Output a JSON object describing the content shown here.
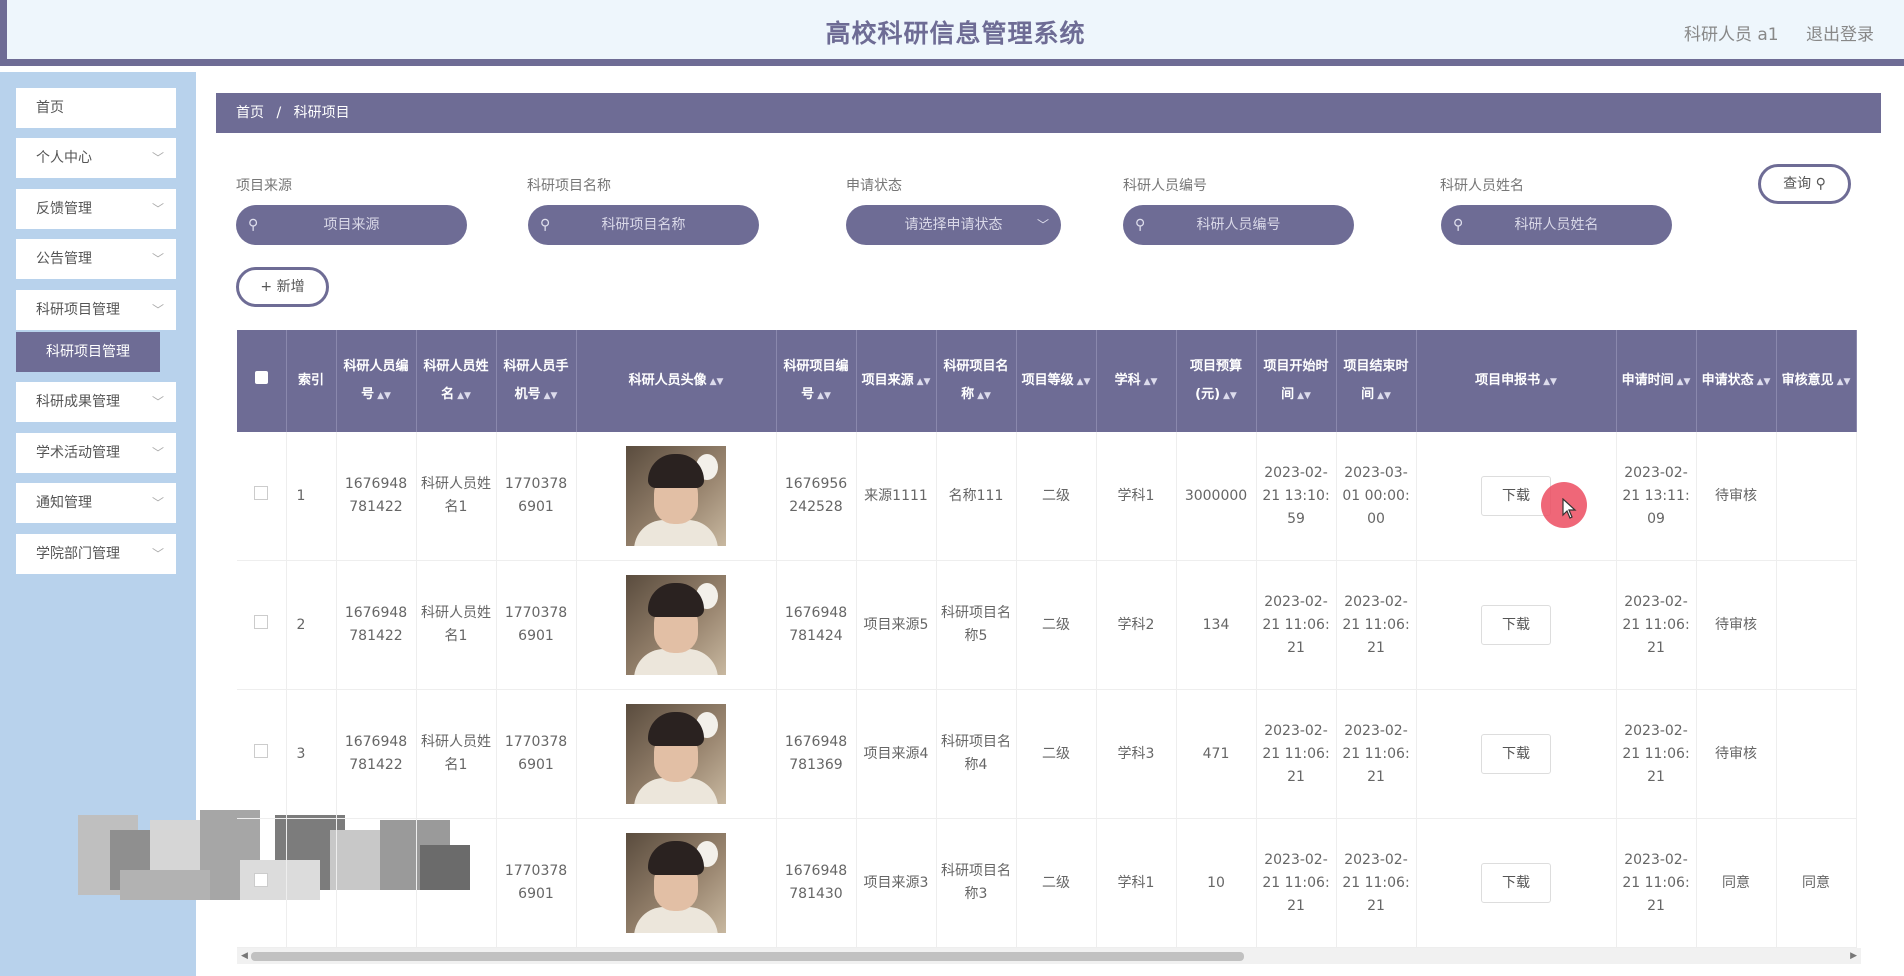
{
  "app": {
    "title": "高校科研信息管理系统"
  },
  "header": {
    "user_label": "科研人员 a1",
    "logout_label": "退出登录"
  },
  "sidebar": {
    "items": [
      {
        "label": "首页"
      },
      {
        "label": "个人中心"
      },
      {
        "label": "反馈管理"
      },
      {
        "label": "公告管理"
      },
      {
        "label": "科研项目管理"
      },
      {
        "label": "科研成果管理"
      },
      {
        "label": "学术活动管理"
      },
      {
        "label": "通知管理"
      },
      {
        "label": "学院部门管理"
      }
    ],
    "active_sub": "科研项目管理"
  },
  "breadcrumb": {
    "home": "首页",
    "separator": "/",
    "current": "科研项目"
  },
  "filters": {
    "source": {
      "label": "项目来源",
      "placeholder": "项目来源"
    },
    "name": {
      "label": "科研项目名称",
      "placeholder": "科研项目名称"
    },
    "status": {
      "label": "申请状态",
      "placeholder": "请选择申请状态"
    },
    "staff_no": {
      "label": "科研人员编号",
      "placeholder": "科研人员编号"
    },
    "staff_name": {
      "label": "科研人员姓名",
      "placeholder": "科研人员姓名"
    },
    "search_label": "查询",
    "add_label": "新增"
  },
  "table": {
    "headers": {
      "index": "索引",
      "staff_no": "科研人员编号",
      "staff_name": "科研人员姓名",
      "phone": "科研人员手机号",
      "avatar": "科研人员头像",
      "project_no": "科研项目编号",
      "source": "项目来源",
      "project_name": "科研项目名称",
      "level": "项目等级",
      "subject": "学科",
      "budget": "项目预算(元)",
      "start": "项目开始时间",
      "end": "项目结束时间",
      "proposal": "项目申报书",
      "apply_time": "申请时间",
      "status": "申请状态",
      "review": "审核意见"
    },
    "rows": [
      {
        "index": "1",
        "staff_no": "1676948781422",
        "staff_name": "科研人员姓名1",
        "phone": "17703786901",
        "project_no": "1676956242528",
        "source": "来源1111",
        "project_name": "名称111",
        "level": "二级",
        "subject": "学科1",
        "budget": "3000000",
        "start": "2023-02-21 13:10:59",
        "end": "2023-03-01 00:00:00",
        "proposal": "下载",
        "apply_time": "2023-02-21 13:11:09",
        "status": "待审核",
        "review": ""
      },
      {
        "index": "2",
        "staff_no": "1676948781422",
        "staff_name": "科研人员姓名1",
        "phone": "17703786901",
        "project_no": "1676948781424",
        "source": "项目来源5",
        "project_name": "科研项目名称5",
        "level": "二级",
        "subject": "学科2",
        "budget": "134",
        "start": "2023-02-21 11:06:21",
        "end": "2023-02-21 11:06:21",
        "proposal": "下载",
        "apply_time": "2023-02-21 11:06:21",
        "status": "待审核",
        "review": ""
      },
      {
        "index": "3",
        "staff_no": "1676948781422",
        "staff_name": "科研人员姓名1",
        "phone": "17703786901",
        "project_no": "1676948781369",
        "source": "项目来源4",
        "project_name": "科研项目名称4",
        "level": "二级",
        "subject": "学科3",
        "budget": "471",
        "start": "2023-02-21 11:06:21",
        "end": "2023-02-21 11:06:21",
        "proposal": "下载",
        "apply_time": "2023-02-21 11:06:21",
        "status": "待审核",
        "review": ""
      },
      {
        "index": "",
        "staff_no": "",
        "staff_name": "",
        "phone": "17703786901",
        "project_no": "1676948781430",
        "source": "项目来源3",
        "project_name": "科研项目名称3",
        "level": "二级",
        "subject": "学科1",
        "budget": "10",
        "start": "2023-02-21 11:06:21",
        "end": "2023-02-21 11:06:21",
        "proposal": "下载",
        "apply_time": "2023-02-21 11:06:21",
        "status": "同意",
        "review": "同意"
      }
    ]
  },
  "colors": {
    "primary": "#6e6c95",
    "sidebar_bg": "#b8d2ec",
    "header_bg": "#eef6fc",
    "cursor": "#ec4c60"
  }
}
